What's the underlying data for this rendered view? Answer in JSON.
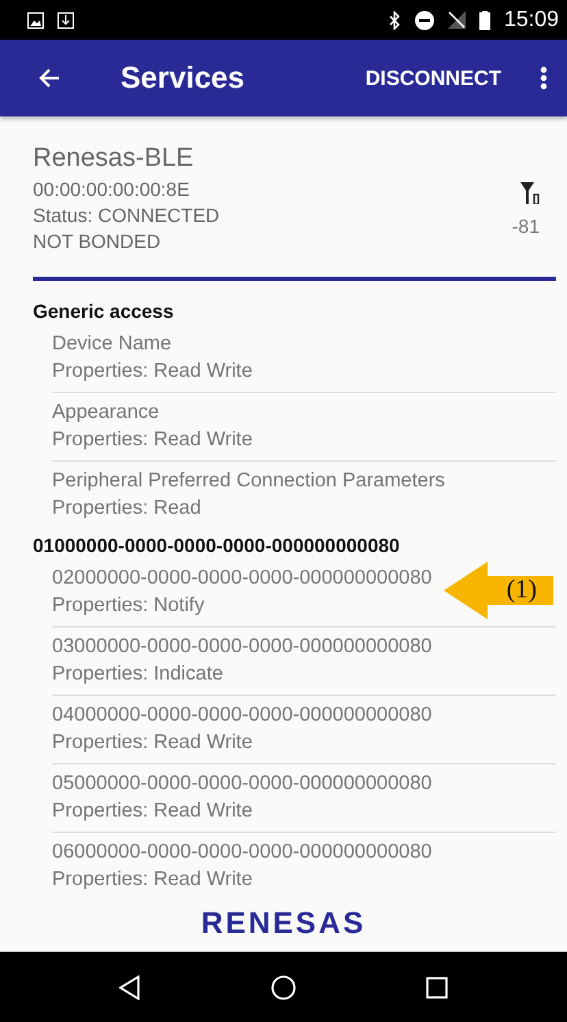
{
  "status_bar": {
    "time": "15:09"
  },
  "app_bar": {
    "title": "Services",
    "action": "DISCONNECT"
  },
  "device": {
    "name": "Renesas-BLE",
    "address": "00:00:00:00:00:8E",
    "status": "Status:  CONNECTED",
    "bond": "NOT BONDED",
    "rssi": "-81"
  },
  "services": [
    {
      "name": "Generic access",
      "characteristics": [
        {
          "name": "Device Name",
          "properties": "Properties: Read Write"
        },
        {
          "name": "Appearance",
          "properties": "Properties: Read Write"
        },
        {
          "name": "Peripheral Preferred Connection Parameters",
          "properties": "Properties: Read"
        }
      ]
    },
    {
      "name": "01000000-0000-0000-0000-000000000080",
      "characteristics": [
        {
          "name": "02000000-0000-0000-0000-000000000080",
          "properties": "Properties: Notify",
          "callout": "(1)"
        },
        {
          "name": "03000000-0000-0000-0000-000000000080",
          "properties": "Properties: Indicate"
        },
        {
          "name": "04000000-0000-0000-0000-000000000080",
          "properties": "Properties: Read Write"
        },
        {
          "name": "05000000-0000-0000-0000-000000000080",
          "properties": "Properties: Read Write"
        },
        {
          "name": "06000000-0000-0000-0000-000000000080",
          "properties": "Properties: Read Write"
        }
      ]
    }
  ],
  "logo": "RENESAS"
}
